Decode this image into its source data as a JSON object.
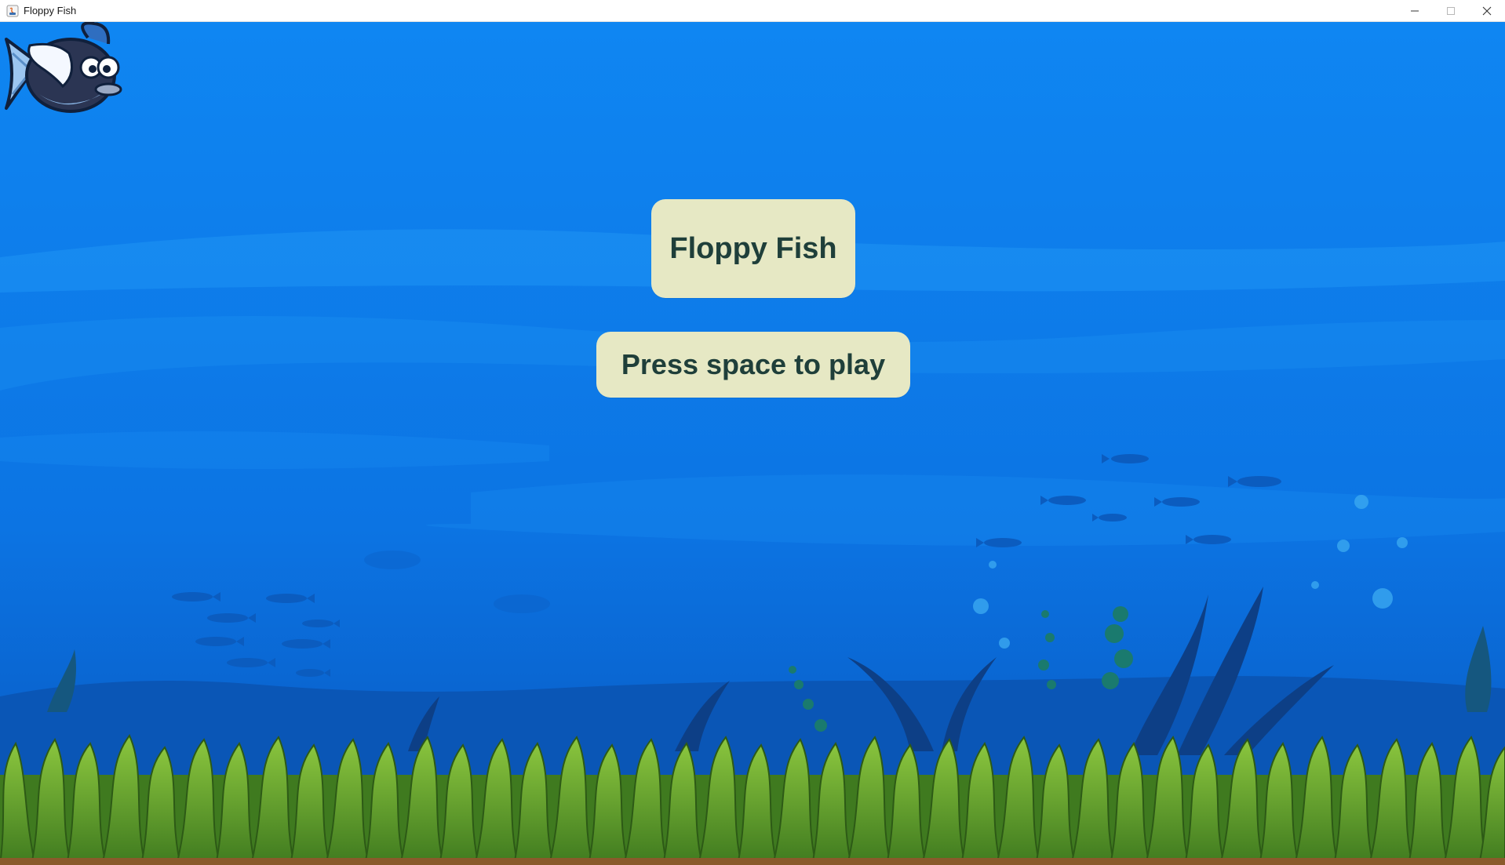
{
  "window": {
    "title": "Floppy Fish",
    "icons": [
      "java-app-icon",
      "minimize-icon",
      "maximize-icon",
      "close-icon"
    ]
  },
  "game": {
    "title_panel": "Floppy Fish",
    "prompt_panel": "Press space to play",
    "player": "fish-character"
  },
  "colors": {
    "water_top": "#0d7ff0",
    "water_bottom": "#0a5fc9",
    "panel_bg": "#e6e8c4",
    "panel_text": "#1f3f3a",
    "seaweed": "#6fae2f"
  }
}
